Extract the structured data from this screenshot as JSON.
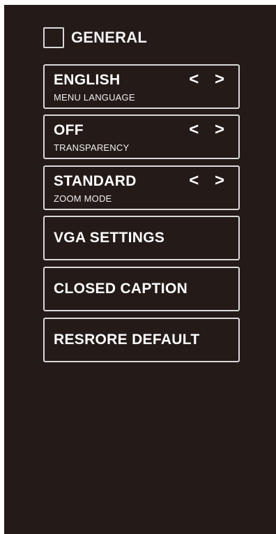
{
  "header": {
    "title": "GENERAL"
  },
  "menu": {
    "items": [
      {
        "value": "ENGLISH",
        "label": "MENU LANGUAGE",
        "arrows": "< >"
      },
      {
        "value": "OFF",
        "label": "TRANSPARENCY",
        "arrows": "< >"
      },
      {
        "value": "STANDARD",
        "label": "ZOOM MODE",
        "arrows": "< >"
      },
      {
        "value": "VGA SETTINGS"
      },
      {
        "value": "CLOSED CAPTION"
      },
      {
        "value": "RESRORE DEFAULT"
      }
    ]
  },
  "colors": {
    "background": "#241a18",
    "border": "#d9d9d9",
    "text": "#ffffff"
  }
}
